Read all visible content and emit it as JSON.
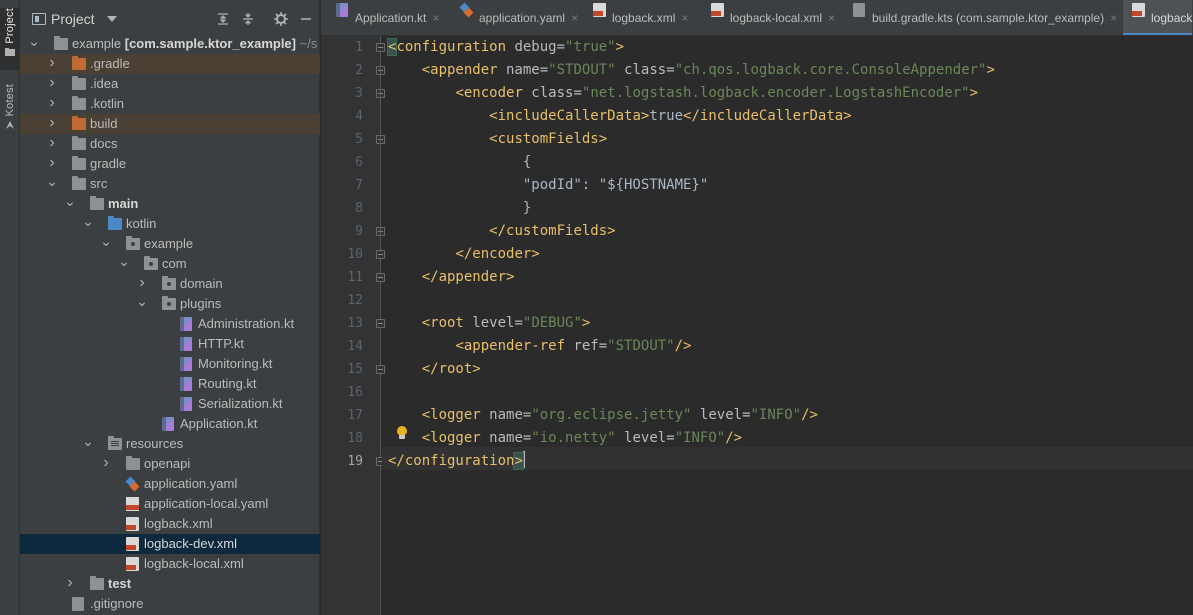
{
  "sidebar_strip": {
    "project_tab": "Project",
    "kotest_tab": "Kotest"
  },
  "project_panel": {
    "title": "Project",
    "tree": [
      {
        "label": "example",
        "suffix": "[com.sample.ktor_example]",
        "extra": "~/s",
        "level": 0,
        "arrow": "down",
        "icon": "folder"
      },
      {
        "label": ".gradle",
        "level": 1,
        "arrow": "right",
        "icon": "folder-orange",
        "highlight": true
      },
      {
        "label": ".idea",
        "level": 1,
        "arrow": "right",
        "icon": "folder"
      },
      {
        "label": ".kotlin",
        "level": 1,
        "arrow": "right",
        "icon": "folder"
      },
      {
        "label": "build",
        "level": 1,
        "arrow": "right",
        "icon": "folder-orange",
        "highlight": true
      },
      {
        "label": "docs",
        "level": 1,
        "arrow": "right",
        "icon": "folder"
      },
      {
        "label": "gradle",
        "level": 1,
        "arrow": "right",
        "icon": "folder"
      },
      {
        "label": "src",
        "level": 1,
        "arrow": "down",
        "icon": "folder"
      },
      {
        "label": "main",
        "level": 2,
        "arrow": "down",
        "icon": "folder",
        "bold": true
      },
      {
        "label": "kotlin",
        "level": 3,
        "arrow": "down",
        "icon": "folder-blue"
      },
      {
        "label": "example",
        "level": 4,
        "arrow": "down",
        "icon": "package"
      },
      {
        "label": "com",
        "level": 5,
        "arrow": "down",
        "icon": "package"
      },
      {
        "label": "domain",
        "level": 6,
        "arrow": "right",
        "icon": "package"
      },
      {
        "label": "plugins",
        "level": 6,
        "arrow": "down",
        "icon": "package"
      },
      {
        "label": "Administration.kt",
        "level": 7,
        "arrow": "none",
        "icon": "kt"
      },
      {
        "label": "HTTP.kt",
        "level": 7,
        "arrow": "none",
        "icon": "kt"
      },
      {
        "label": "Monitoring.kt",
        "level": 7,
        "arrow": "none",
        "icon": "kt"
      },
      {
        "label": "Routing.kt",
        "level": 7,
        "arrow": "none",
        "icon": "kt"
      },
      {
        "label": "Serialization.kt",
        "level": 7,
        "arrow": "none",
        "icon": "kt"
      },
      {
        "label": "Application.kt",
        "level": 6,
        "arrow": "none",
        "icon": "kt"
      },
      {
        "label": "resources",
        "level": 3,
        "arrow": "down",
        "icon": "resources"
      },
      {
        "label": "openapi",
        "level": 4,
        "arrow": "right",
        "icon": "folder"
      },
      {
        "label": "application.yaml",
        "level": 4,
        "arrow": "none",
        "icon": "yaml"
      },
      {
        "label": "application-local.yaml",
        "level": 4,
        "arrow": "none",
        "icon": "yaml-red"
      },
      {
        "label": "logback.xml",
        "level": 4,
        "arrow": "none",
        "icon": "xml"
      },
      {
        "label": "logback-dev.xml",
        "level": 4,
        "arrow": "none",
        "icon": "xml",
        "selected": true
      },
      {
        "label": "logback-local.xml",
        "level": 4,
        "arrow": "none",
        "icon": "xml"
      },
      {
        "label": "test",
        "level": 2,
        "arrow": "right",
        "icon": "folder",
        "bold": true
      },
      {
        "label": ".gitignore",
        "level": 1,
        "arrow": "none",
        "icon": "git"
      }
    ]
  },
  "editor_tabs": [
    {
      "label": "Application.kt",
      "icon": "kt"
    },
    {
      "label": "application.yaml",
      "icon": "yaml"
    },
    {
      "label": "logback.xml",
      "icon": "xml"
    },
    {
      "label": "logback-local.xml",
      "icon": "xml"
    },
    {
      "label": "build.gradle.kts (com.sample.ktor_example)",
      "icon": "gradle"
    },
    {
      "label": "logback",
      "icon": "xml",
      "active": true
    }
  ],
  "editor": {
    "current_line": "19",
    "lines": [
      {
        "n": "1",
        "tokens": [
          [
            "<",
            "tg"
          ],
          [
            "configuration",
            "tg"
          ],
          [
            " debug",
            "at"
          ],
          [
            "=",
            "at"
          ],
          [
            "\"true\"",
            "av"
          ],
          [
            ">",
            "tg"
          ]
        ]
      },
      {
        "n": "2",
        "tokens": [
          [
            "    ",
            "tx"
          ],
          [
            "<appender",
            "tg"
          ],
          [
            " name",
            "at"
          ],
          [
            "=",
            "at"
          ],
          [
            "\"STDOUT\"",
            "av"
          ],
          [
            " class",
            "at"
          ],
          [
            "=",
            "at"
          ],
          [
            "\"ch.qos.logback.core.ConsoleAppender\"",
            "av"
          ],
          [
            ">",
            "tg"
          ]
        ]
      },
      {
        "n": "3",
        "tokens": [
          [
            "        ",
            "tx"
          ],
          [
            "<encoder",
            "tg"
          ],
          [
            " class",
            "at"
          ],
          [
            "=",
            "at"
          ],
          [
            "\"net.logstash.logback.encoder.LogstashEncoder\"",
            "av"
          ],
          [
            ">",
            "tg"
          ]
        ]
      },
      {
        "n": "4",
        "tokens": [
          [
            "            ",
            "tx"
          ],
          [
            "<includeCallerData>",
            "tg"
          ],
          [
            "true",
            "tx"
          ],
          [
            "</includeCallerData>",
            "tg"
          ]
        ]
      },
      {
        "n": "5",
        "tokens": [
          [
            "            ",
            "tx"
          ],
          [
            "<customFields>",
            "tg"
          ]
        ]
      },
      {
        "n": "6",
        "tokens": [
          [
            "                {",
            "tx"
          ]
        ]
      },
      {
        "n": "7",
        "tokens": [
          [
            "                \"podId\": \"${HOSTNAME}\"",
            "tx"
          ]
        ]
      },
      {
        "n": "8",
        "tokens": [
          [
            "                }",
            "tx"
          ]
        ]
      },
      {
        "n": "9",
        "tokens": [
          [
            "            ",
            "tx"
          ],
          [
            "</customFields>",
            "tg"
          ]
        ]
      },
      {
        "n": "10",
        "tokens": [
          [
            "        ",
            "tx"
          ],
          [
            "</encoder>",
            "tg"
          ]
        ]
      },
      {
        "n": "11",
        "tokens": [
          [
            "    ",
            "tx"
          ],
          [
            "</appender>",
            "tg"
          ]
        ]
      },
      {
        "n": "12",
        "tokens": []
      },
      {
        "n": "13",
        "tokens": [
          [
            "    ",
            "tx"
          ],
          [
            "<root",
            "tg"
          ],
          [
            " level",
            "at"
          ],
          [
            "=",
            "at"
          ],
          [
            "\"DEBUG\"",
            "av"
          ],
          [
            ">",
            "tg"
          ]
        ]
      },
      {
        "n": "14",
        "tokens": [
          [
            "        ",
            "tx"
          ],
          [
            "<appender-ref",
            "tg"
          ],
          [
            " ref",
            "at"
          ],
          [
            "=",
            "at"
          ],
          [
            "\"STDOUT\"",
            "av"
          ],
          [
            "/>",
            "tg"
          ]
        ]
      },
      {
        "n": "15",
        "tokens": [
          [
            "    ",
            "tx"
          ],
          [
            "</root>",
            "tg"
          ]
        ]
      },
      {
        "n": "16",
        "tokens": []
      },
      {
        "n": "17",
        "tokens": [
          [
            "    ",
            "tx"
          ],
          [
            "<logger",
            "tg"
          ],
          [
            " name",
            "at"
          ],
          [
            "=",
            "at"
          ],
          [
            "\"org.eclipse.jetty\"",
            "av"
          ],
          [
            " level",
            "at"
          ],
          [
            "=",
            "at"
          ],
          [
            "\"INFO\"",
            "av"
          ],
          [
            "/>",
            "tg"
          ]
        ]
      },
      {
        "n": "18",
        "tokens": [
          [
            "    ",
            "tx"
          ],
          [
            "<logger",
            "tg"
          ],
          [
            " name",
            "at"
          ],
          [
            "=",
            "at"
          ],
          [
            "\"io.netty\"",
            "av"
          ],
          [
            " level",
            "at"
          ],
          [
            "=",
            "at"
          ],
          [
            "\"INFO\"",
            "av"
          ],
          [
            "/>",
            "tg"
          ]
        ]
      },
      {
        "n": "19",
        "tokens": [
          [
            "</configuration",
            "tg"
          ],
          [
            ">",
            "tg"
          ]
        ]
      }
    ]
  }
}
